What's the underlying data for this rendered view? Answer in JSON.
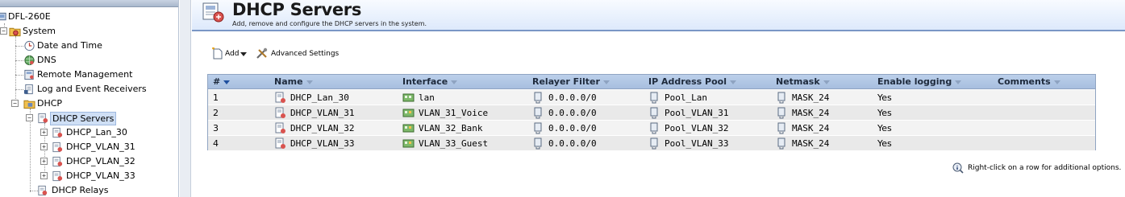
{
  "tree": {
    "root": "DFL-260E",
    "items": [
      {
        "label": "System",
        "icon": "gear-folder-icon"
      },
      {
        "label": "Date and Time",
        "icon": "clock-icon"
      },
      {
        "label": "DNS",
        "icon": "globe-icon"
      },
      {
        "label": "Remote Management",
        "icon": "remote-management-icon"
      },
      {
        "label": "Log and Event Receivers",
        "icon": "log-icon"
      },
      {
        "label": "DHCP",
        "icon": "folder-icon"
      },
      {
        "label": "DHCP Servers",
        "icon": "dhcp-server-icon"
      },
      {
        "label": "DHCP_Lan_30",
        "icon": "dhcp-server-icon"
      },
      {
        "label": "DHCP_VLAN_31",
        "icon": "dhcp-server-icon"
      },
      {
        "label": "DHCP_VLAN_32",
        "icon": "dhcp-server-icon"
      },
      {
        "label": "DHCP_VLAN_33",
        "icon": "dhcp-server-icon"
      },
      {
        "label": "DHCP Relays",
        "icon": "dhcp-relay-icon"
      }
    ]
  },
  "header": {
    "title": "DHCP Servers",
    "subtitle": "Add, remove and configure the DHCP servers in the system."
  },
  "toolbar": {
    "add_label": "Add",
    "advanced_label": "Advanced Settings"
  },
  "table": {
    "columns": [
      "#",
      "Name",
      "Interface",
      "Relayer Filter",
      "IP Address Pool",
      "Netmask",
      "Enable logging",
      "Comments"
    ],
    "rows": [
      {
        "index": "1",
        "name": "DHCP_Lan_30",
        "interface": "lan",
        "relayer_filter": "0.0.0.0/0",
        "pool": "Pool_Lan",
        "netmask": "MASK_24",
        "logging": "Yes",
        "comments": ""
      },
      {
        "index": "2",
        "name": "DHCP_VLAN_31",
        "interface": "VLAN_31_Voice",
        "relayer_filter": "0.0.0.0/0",
        "pool": "Pool_VLAN_31",
        "netmask": "MASK_24",
        "logging": "Yes",
        "comments": ""
      },
      {
        "index": "3",
        "name": "DHCP_VLAN_32",
        "interface": "VLAN_32_Bank",
        "relayer_filter": "0.0.0.0/0",
        "pool": "Pool_VLAN_32",
        "netmask": "MASK_24",
        "logging": "Yes",
        "comments": ""
      },
      {
        "index": "4",
        "name": "DHCP_VLAN_33",
        "interface": "VLAN_33_Guest",
        "relayer_filter": "0.0.0.0/0",
        "pool": "Pool_VLAN_33",
        "netmask": "MASK_24",
        "logging": "Yes",
        "comments": ""
      }
    ]
  },
  "hint": "Right-click on a row for additional options."
}
